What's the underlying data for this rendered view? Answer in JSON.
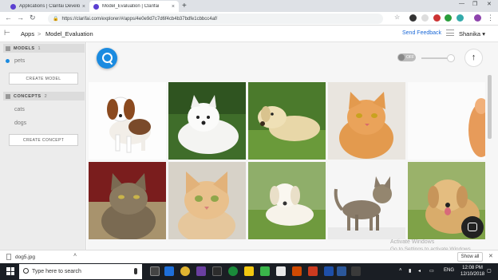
{
  "browser": {
    "tabs": [
      {
        "label": "Applications | Clarifai Developer",
        "active": false
      },
      {
        "label": "Model_Evaluation | Clarifai",
        "active": true
      }
    ],
    "url": "https://clarifai.com/explorer/#/apps/4e0e9d7c7d6f4cb4b37bdfe1cbbcc4af/"
  },
  "header": {
    "breadcrumb_root": "Apps",
    "breadcrumb_sep": ">",
    "breadcrumb_current": "Model_Evaluation",
    "send_feedback": "Send Feedback",
    "user": "Shanika",
    "user_chevron": "▾"
  },
  "sidebar": {
    "models_label": "MODELS",
    "models_count": "1",
    "models": [
      "pets"
    ],
    "create_model": "CREATE MODEL",
    "concepts_label": "CONCEPTS",
    "concepts_count": "2",
    "concepts": [
      "cats",
      "dogs"
    ],
    "create_concept": "CREATE CONCEPT"
  },
  "main": {
    "toggle_label": "OFF",
    "toggle_on": false,
    "slider_level_pct": 85,
    "images": [
      {
        "subject": "dog",
        "desc": "beagle puppy"
      },
      {
        "subject": "dog",
        "desc": "samoyed"
      },
      {
        "subject": "dog",
        "desc": "labrador lying on grass"
      },
      {
        "subject": "cat",
        "desc": "orange tabby cat"
      },
      {
        "subject": "cat",
        "desc": "ginger cat partial"
      },
      {
        "subject": "cat",
        "desc": "brown tabby cat"
      },
      {
        "subject": "cat",
        "desc": "ginger kitten"
      },
      {
        "subject": "dog",
        "desc": "white puppy on grass"
      },
      {
        "subject": "cat",
        "desc": "tabby cat standing"
      },
      {
        "subject": "dog",
        "desc": "golden retriever"
      }
    ]
  },
  "watermark": {
    "line1": "Activate Windows",
    "line2": "Go to Settings to activate Windows."
  },
  "download_bar": {
    "file": "dog5.jpg",
    "show_all": "Show all"
  },
  "taskbar": {
    "search_placeholder": "Type here to search",
    "lang": "ENG",
    "time": "12:08 PM",
    "date": "12/10/2018"
  },
  "colors": {
    "accent": "#1b8be0",
    "link": "#1d6ad7",
    "taskbar": "#1a1e24"
  }
}
